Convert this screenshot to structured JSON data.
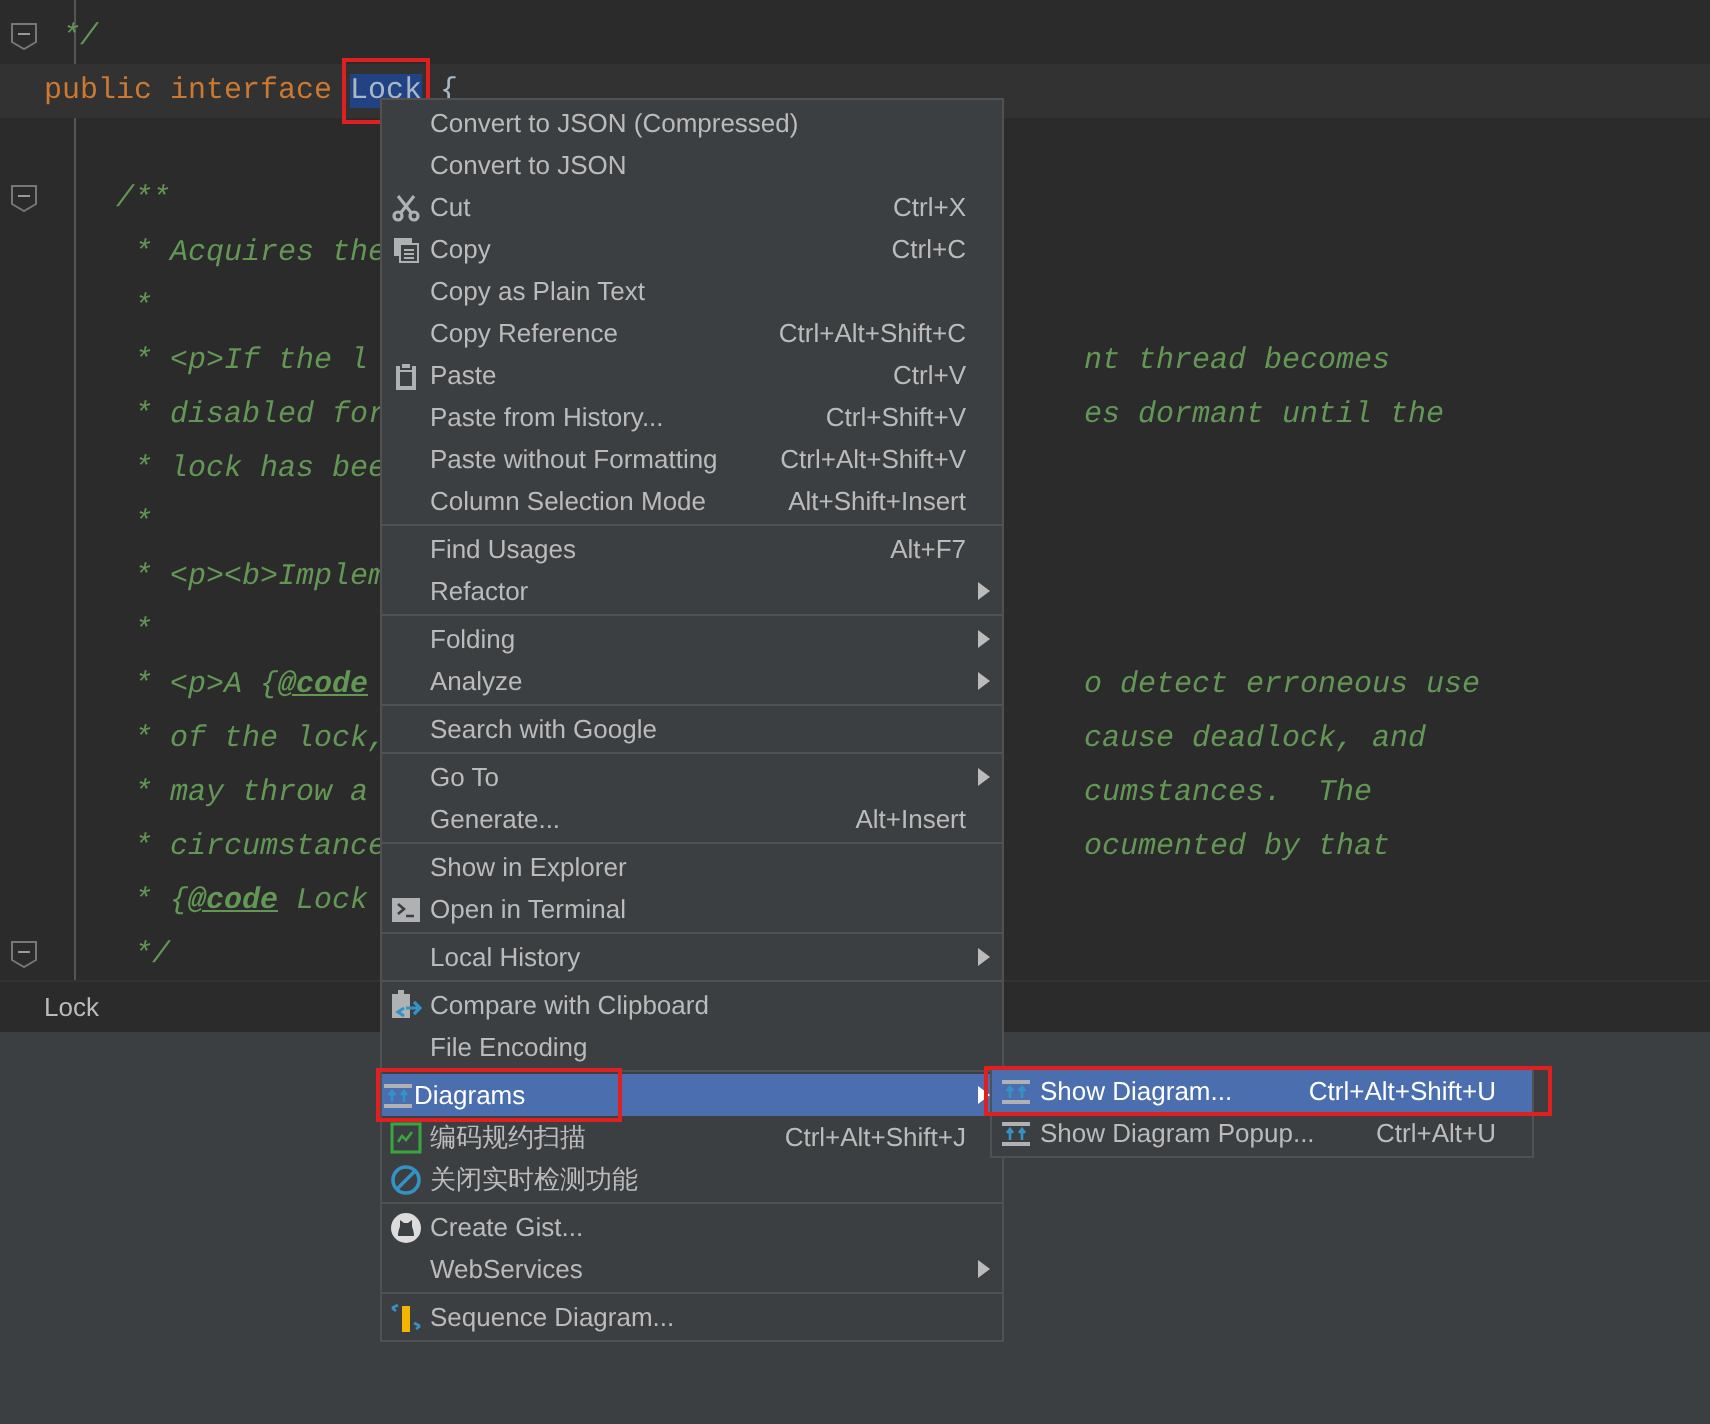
{
  "editor": {
    "lines": [
      {
        "kind": "top-close",
        "fold": true,
        "current": false,
        "text": "*/"
      },
      {
        "kind": "decl",
        "fold": false,
        "current": true,
        "parts": [
          {
            "kind": "keyword",
            "text": "public interface ",
            "selected": false,
            "highlighted": false
          },
          {
            "kind": "identifier",
            "text": "Lock",
            "selected": true,
            "highlighted": true
          },
          {
            "kind": "plain",
            "text": " {",
            "selected": false,
            "highlighted": false
          }
        ]
      },
      {
        "kind": "blank",
        "fold": false,
        "current": false
      },
      {
        "kind": "doc-open",
        "fold": true,
        "current": false,
        "text": "/**"
      },
      {
        "kind": "doc",
        "fold": false,
        "current": false,
        "text": "* Acquires the"
      },
      {
        "kind": "doc",
        "fold": false,
        "current": false,
        "text": "*"
      },
      {
        "kind": "doc",
        "fold": false,
        "current": false,
        "text": "* <p>If the l",
        "right": "nt thread becomes"
      },
      {
        "kind": "doc",
        "fold": false,
        "current": false,
        "text": "* disabled for",
        "right": "es dormant until the"
      },
      {
        "kind": "doc",
        "fold": false,
        "current": false,
        "text": "* lock has bee"
      },
      {
        "kind": "doc",
        "fold": false,
        "current": false,
        "text": "*"
      },
      {
        "kind": "doc",
        "fold": false,
        "current": false,
        "text": "* <p><b>Implem"
      },
      {
        "kind": "doc",
        "fold": false,
        "current": false,
        "text": "*"
      },
      {
        "kind": "doc",
        "fold": false,
        "current": false,
        "text": "* <p>A {**@code**",
        "right": "o detect erroneous use"
      },
      {
        "kind": "doc",
        "fold": false,
        "current": false,
        "text": "* of the lock,",
        "right": "cause deadlock, and"
      },
      {
        "kind": "doc",
        "fold": false,
        "current": false,
        "text": "* may throw a",
        "right": "cumstances.  The"
      },
      {
        "kind": "doc",
        "fold": false,
        "current": false,
        "text": "* circumstance",
        "right": "ocumented by that"
      },
      {
        "kind": "doc",
        "fold": false,
        "current": false,
        "text": "* {**@code** Lock"
      },
      {
        "kind": "doc",
        "fold": true,
        "current": false,
        "text": "*/"
      }
    ]
  },
  "breadcrumb": "Lock",
  "context_menu": {
    "items": [
      {
        "kind": "item",
        "label": "Convert to JSON (Compressed)",
        "selected": false,
        "submenu": false,
        "highlighted": false
      },
      {
        "kind": "item",
        "label": "Convert to JSON",
        "selected": false,
        "submenu": false,
        "highlighted": false
      },
      {
        "kind": "item",
        "label": "Cut",
        "shortcut": "Ctrl+X",
        "selected": false,
        "submenu": false,
        "highlighted": false
      },
      {
        "kind": "item",
        "label": "Copy",
        "shortcut": "Ctrl+C",
        "selected": false,
        "submenu": false,
        "highlighted": false
      },
      {
        "kind": "item",
        "label": "Copy as Plain Text",
        "selected": false,
        "submenu": false,
        "highlighted": false
      },
      {
        "kind": "item",
        "label": "Copy Reference",
        "shortcut": "Ctrl+Alt+Shift+C",
        "selected": false,
        "submenu": false,
        "highlighted": false
      },
      {
        "kind": "item",
        "label": "Paste",
        "shortcut": "Ctrl+V",
        "selected": false,
        "submenu": false,
        "highlighted": false
      },
      {
        "kind": "item",
        "label": "Paste from History...",
        "shortcut": "Ctrl+Shift+V",
        "selected": false,
        "submenu": false,
        "highlighted": false
      },
      {
        "kind": "item",
        "label": "Paste without Formatting",
        "shortcut": "Ctrl+Alt+Shift+V",
        "selected": false,
        "submenu": false,
        "highlighted": false
      },
      {
        "kind": "item",
        "label": "Column Selection Mode",
        "shortcut": "Alt+Shift+Insert",
        "selected": false,
        "submenu": false,
        "highlighted": false
      },
      {
        "kind": "separator"
      },
      {
        "kind": "item",
        "label": "Find Usages",
        "shortcut": "Alt+F7",
        "selected": false,
        "submenu": false,
        "highlighted": false
      },
      {
        "kind": "item",
        "label": "Refactor",
        "selected": false,
        "submenu": true,
        "highlighted": false
      },
      {
        "kind": "separator"
      },
      {
        "kind": "item",
        "label": "Folding",
        "selected": false,
        "submenu": true,
        "highlighted": false
      },
      {
        "kind": "item",
        "label": "Analyze",
        "selected": false,
        "submenu": true,
        "highlighted": false
      },
      {
        "kind": "separator"
      },
      {
        "kind": "item",
        "label": "Search with Google",
        "selected": false,
        "submenu": false,
        "highlighted": false
      },
      {
        "kind": "separator"
      },
      {
        "kind": "item",
        "label": "Go To",
        "selected": false,
        "submenu": true,
        "highlighted": false
      },
      {
        "kind": "item",
        "label": "Generate...",
        "shortcut": "Alt+Insert",
        "selected": false,
        "submenu": false,
        "highlighted": false
      },
      {
        "kind": "separator"
      },
      {
        "kind": "item",
        "label": "Show in Explorer",
        "selected": false,
        "submenu": false,
        "highlighted": false
      },
      {
        "kind": "item",
        "label": "Open in Terminal",
        "selected": false,
        "submenu": false,
        "highlighted": false
      },
      {
        "kind": "separator"
      },
      {
        "kind": "item",
        "label": "Local History",
        "selected": false,
        "submenu": true,
        "highlighted": false
      },
      {
        "kind": "separator"
      },
      {
        "kind": "item",
        "label": "Compare with Clipboard",
        "selected": false,
        "submenu": false,
        "highlighted": false
      },
      {
        "kind": "item",
        "label": "File Encoding",
        "selected": false,
        "submenu": false,
        "highlighted": false
      },
      {
        "kind": "separator"
      },
      {
        "kind": "item",
        "label": "Diagrams",
        "selected": true,
        "submenu": true,
        "highlighted": true
      },
      {
        "kind": "item",
        "label": "编码规约扫描",
        "shortcut": "Ctrl+Alt+Shift+J",
        "selected": false,
        "submenu": false,
        "highlighted": false
      },
      {
        "kind": "item",
        "label": "关闭实时检测功能",
        "selected": false,
        "submenu": false,
        "highlighted": false
      },
      {
        "kind": "separator"
      },
      {
        "kind": "item",
        "label": "Create Gist...",
        "selected": false,
        "submenu": false,
        "highlighted": false
      },
      {
        "kind": "item",
        "label": "WebServices",
        "selected": false,
        "submenu": true,
        "highlighted": false
      },
      {
        "kind": "separator"
      },
      {
        "kind": "item",
        "label": "Sequence Diagram...",
        "selected": false,
        "submenu": false,
        "highlighted": false
      }
    ]
  },
  "submenu": {
    "items": [
      {
        "kind": "item",
        "label": "Show Diagram...",
        "shortcut": "Ctrl+Alt+Shift+U",
        "selected": true,
        "submenu": false,
        "highlighted": true
      },
      {
        "kind": "item",
        "label": "Show Diagram Popup...",
        "shortcut": "Ctrl+Alt+U",
        "selected": false,
        "submenu": false,
        "highlighted": false
      }
    ]
  }
}
